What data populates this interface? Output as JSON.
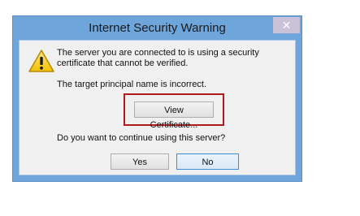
{
  "dialog": {
    "title": "Internet Security Warning",
    "close_glyph": "✕",
    "icon": "warning-icon",
    "message_line1": "The server you are connected to is using a security certificate that cannot be verified.",
    "message_line2": "The target principal name is incorrect.",
    "question": "Do you want to continue using this server?",
    "buttons": {
      "view_certificate": "View Certificate...",
      "yes": "Yes",
      "no": "No"
    }
  },
  "colors": {
    "frame": "#6ea5db",
    "client": "#f0f0f0",
    "highlight": "#b01a1a",
    "close_button": "#c9c2d8"
  }
}
